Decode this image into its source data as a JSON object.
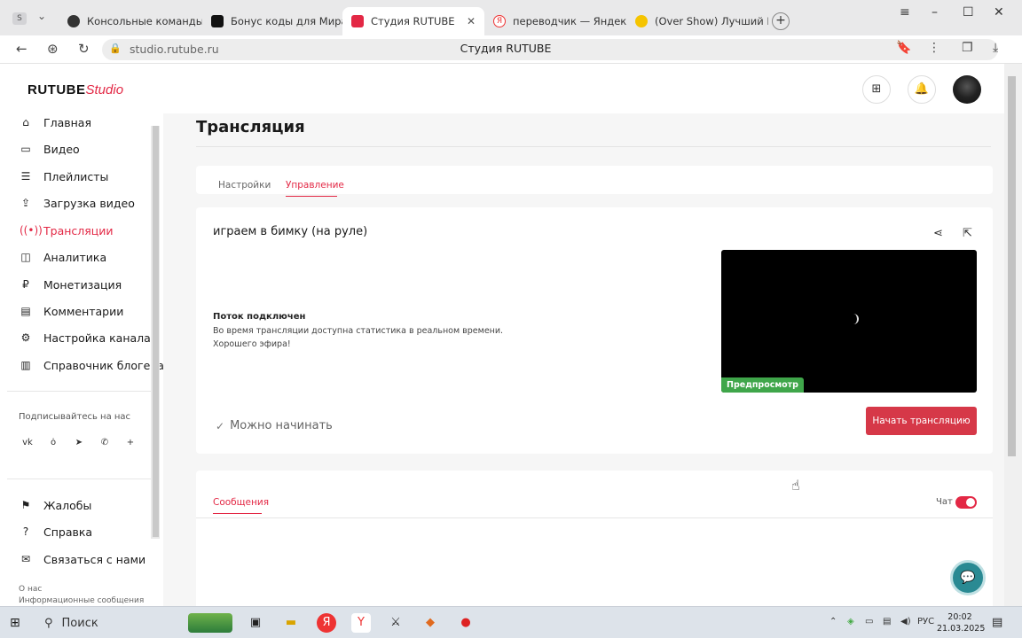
{
  "browser": {
    "tabs": [
      {
        "label": "Консольные команды | Tl",
        "active": false
      },
      {
        "label": "Бонус коды для Мира та",
        "active": false
      },
      {
        "label": "Студия RUTUBE",
        "active": true
      },
      {
        "label": "переводчик — Яндекс: на",
        "active": false
      },
      {
        "label": "(Over Show) Лучший Пое",
        "active": false
      }
    ],
    "sys_badge": "S",
    "url": "studio.rutube.ru",
    "page_title": "Студия RUTUBE"
  },
  "header": {
    "logo_main": "RUTUBE",
    "logo_studio": "Studio"
  },
  "sidebar": {
    "items": [
      {
        "label": "Главная",
        "icon": "home-icon",
        "active": false
      },
      {
        "label": "Видео",
        "icon": "video-icon",
        "active": false
      },
      {
        "label": "Плейлисты",
        "icon": "playlist-icon",
        "active": false
      },
      {
        "label": "Загрузка видео",
        "icon": "upload-icon",
        "active": false
      },
      {
        "label": "Трансляции",
        "icon": "broadcast-icon",
        "active": true
      },
      {
        "label": "Аналитика",
        "icon": "analytics-icon",
        "active": false
      },
      {
        "label": "Монетизация",
        "icon": "ruble-icon",
        "active": false
      },
      {
        "label": "Комментарии",
        "icon": "comment-icon",
        "active": false
      },
      {
        "label": "Настройка канала",
        "icon": "settings-icon",
        "active": false
      },
      {
        "label": "Справочник блогера",
        "icon": "book-icon",
        "active": false
      }
    ],
    "follow_label": "Подписывайтесь на нас",
    "social": [
      "vk-icon",
      "ok-icon",
      "telegram-icon",
      "viber-icon",
      "plus-icon"
    ],
    "bottom_items": [
      {
        "label": "Жалобы",
        "icon": "flag-icon"
      },
      {
        "label": "Справка",
        "icon": "help-icon"
      },
      {
        "label": "Связаться с нами",
        "icon": "mail-icon"
      }
    ],
    "footer_links": [
      "О нас",
      "Информационные сообщения"
    ]
  },
  "main": {
    "title": "Трансляция",
    "tabs": [
      {
        "label": "Настройки",
        "active": false
      },
      {
        "label": "Управление",
        "active": true
      }
    ],
    "stream": {
      "title": "играем в бимку (на руле)",
      "status_heading": "Поток подключен",
      "status_line1": "Во время трансляции доступна статистика в реальном времени.",
      "status_line2": "Хорошего эфира!",
      "preview_badge": "Предпросмотр",
      "ready_label": "Можно начинать",
      "start_button": "Начать трансляцию"
    },
    "messages": {
      "tab_label": "Сообщения",
      "chat_label": "Чат",
      "chat_enabled": true
    }
  },
  "taskbar": {
    "search_label": "Поиск",
    "lang": "РУС",
    "time": "20:02",
    "date": "21.03.2025"
  },
  "colors": {
    "accent": "#e32845",
    "start_button": "#d63848",
    "preview_badge": "#3fa64a",
    "help_fab": "#2a8a93"
  }
}
